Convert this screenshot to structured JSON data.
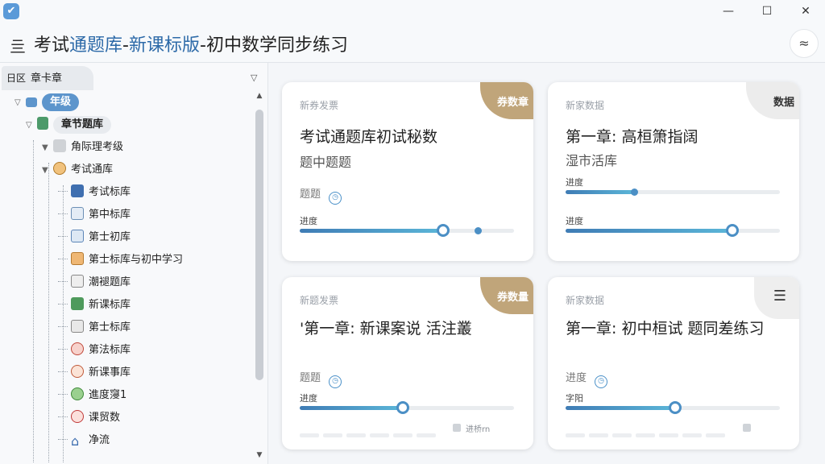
{
  "window": {
    "app_icon": "✔",
    "minimize": "—",
    "maximize": "☐",
    "close": "✕"
  },
  "header": {
    "icon": "亖",
    "title_a": "考试",
    "title_b": "通题库",
    "title_c": "-",
    "title_d": "新课标版",
    "title_e": "-初中数学同步练习",
    "action_icon": "≈"
  },
  "sidebar": {
    "tab_icon": "日区",
    "tab_label": "章卡章",
    "filter_icon": "▽",
    "tree": [
      {
        "label": "年级",
        "style": "pill-blue"
      },
      {
        "label": "章节题库",
        "style": "pill-gray"
      },
      {
        "label": "角际理考级"
      },
      {
        "label": "考试通库"
      },
      {
        "label": "考试标库"
      },
      {
        "label": "第中标库"
      },
      {
        "label": "第士初库"
      },
      {
        "label": "第士标库与初中学习"
      },
      {
        "label": "潮褪题库"
      },
      {
        "label": "新课标库"
      },
      {
        "label": "第士标库"
      },
      {
        "label": "第法标库"
      },
      {
        "label": "新课事库"
      },
      {
        "label": "進度䆮1"
      },
      {
        "label": "课贸数"
      },
      {
        "label": "净流"
      }
    ],
    "scroll_up": "▲",
    "scroll_down": "▼"
  },
  "cards": [
    {
      "category": "新券发票",
      "corner": "券数章",
      "title": "考试通题库初试秘数",
      "subtitle": "题中题题",
      "meta": "题题",
      "progress_label": "进度",
      "progress": 0.67,
      "progress_extra": 0.83
    },
    {
      "category": "新家数据",
      "corner": "数据",
      "title": "第一章: 高桓箫指阔",
      "subtitle": "湿市活库",
      "progress_label_1": "进度",
      "progress_1": 0.32,
      "progress_label_2": "进度",
      "progress_2": 0.78
    },
    {
      "category": "新题发票",
      "corner": "券数量",
      "title": "'第一章: 新课案说 活注叢",
      "meta": "题题",
      "progress_label": "进度",
      "progress": 0.48,
      "footer": "进桥rn"
    },
    {
      "category": "新家数据",
      "corner_icon": "☰",
      "title": "第一章: 初中桓试 题同差练习",
      "meta": "进度",
      "progress_label": "字阳",
      "progress": 0.51
    }
  ],
  "colors": {
    "accent": "#4b8fc5",
    "corner_gold": "#c0a57a",
    "title_highlight": "#2d6aa8"
  }
}
